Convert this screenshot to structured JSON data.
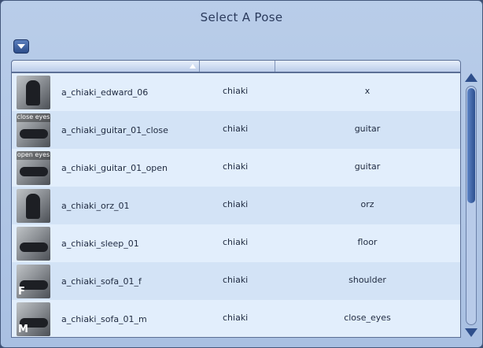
{
  "window": {
    "title": "Select A Pose"
  },
  "rows": [
    {
      "name": "a_chiaki_edward_06",
      "character": "chiaki",
      "category": "x",
      "thumb_text": "",
      "thumb_letter": ""
    },
    {
      "name": "a_chiaki_guitar_01_close",
      "character": "chiaki",
      "category": "guitar",
      "thumb_text": "close eyes",
      "thumb_letter": ""
    },
    {
      "name": "a_chiaki_guitar_01_open",
      "character": "chiaki",
      "category": "guitar",
      "thumb_text": "open eyes",
      "thumb_letter": ""
    },
    {
      "name": "a_chiaki_orz_01",
      "character": "chiaki",
      "category": "orz",
      "thumb_text": "",
      "thumb_letter": ""
    },
    {
      "name": "a_chiaki_sleep_01",
      "character": "chiaki",
      "category": "floor",
      "thumb_text": "",
      "thumb_letter": ""
    },
    {
      "name": "a_chiaki_sofa_01_f",
      "character": "chiaki",
      "category": "shoulder",
      "thumb_text": "",
      "thumb_letter": "F"
    },
    {
      "name": "a_chiaki_sofa_01_m",
      "character": "chiaki",
      "category": "close_eyes",
      "thumb_text": "",
      "thumb_letter": "M"
    }
  ],
  "scrollbar": {
    "position": 0.0,
    "visible_fraction": 0.48
  },
  "icons": {
    "dropdown": "chevron-down-icon",
    "sort": "sort-ascending-icon",
    "scroll_up": "scroll-up-arrow-icon",
    "scroll_down": "scroll-down-arrow-icon"
  },
  "colors": {
    "accent": "#2f4f8c",
    "row_alt": "#d3e3f6",
    "row": "#e2eefc"
  }
}
